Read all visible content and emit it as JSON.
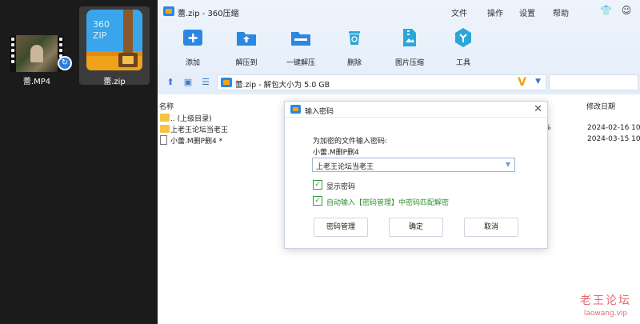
{
  "desktop": {
    "items": [
      {
        "label": "蕾.MP4",
        "icon": "video-file-icon"
      },
      {
        "label": "蕾.zip",
        "icon": "360zip-archive-icon"
      }
    ],
    "zip_icon_text": "360\nZIP"
  },
  "window": {
    "title": "蕾.zip - 360压缩",
    "menu": [
      "文件",
      "操作",
      "设置",
      "帮助"
    ],
    "toolbar": [
      {
        "label": "添加",
        "icon": "add-icon"
      },
      {
        "label": "解压到",
        "icon": "extract-to-icon"
      },
      {
        "label": "一键解压",
        "icon": "one-click-extract-icon"
      },
      {
        "label": "删除",
        "icon": "delete-icon"
      },
      {
        "label": "图片压缩",
        "icon": "image-compress-icon"
      },
      {
        "label": "工具",
        "icon": "tools-icon"
      }
    ],
    "address": "蕾.zip - 解包大小为 5.0 GB"
  },
  "filelist": {
    "headers": {
      "name": "名称",
      "date": "修改日期"
    },
    "rows": [
      {
        "name": ".. (上级目录)",
        "type": "folder",
        "date": "",
        "extra": ""
      },
      {
        "name": "上老王论坛当老王",
        "type": "folder",
        "date": "2024-02-16 10",
        "extra": "%"
      },
      {
        "name": "小蕾.M删P删4 *",
        "type": "file",
        "date": "2024-03-15 10",
        "extra": ""
      }
    ]
  },
  "dialog": {
    "title": "输入密码",
    "prompt": "为加密的文件输入密码:",
    "filename": "小蕾.M删P删4",
    "password_value": "上老王论坛当老王",
    "show_password": "显示密码",
    "auto_input": "自动输入【密码管理】中密码匹配解密",
    "buttons": {
      "manage": "密码管理",
      "ok": "确定",
      "cancel": "取消"
    }
  },
  "watermark": {
    "line1": "老王论坛",
    "line2": "laowang.vip"
  },
  "colors": {
    "accent": "#2b87e3",
    "check": "#3a9a3a",
    "link_green": "#2f8f2f"
  }
}
